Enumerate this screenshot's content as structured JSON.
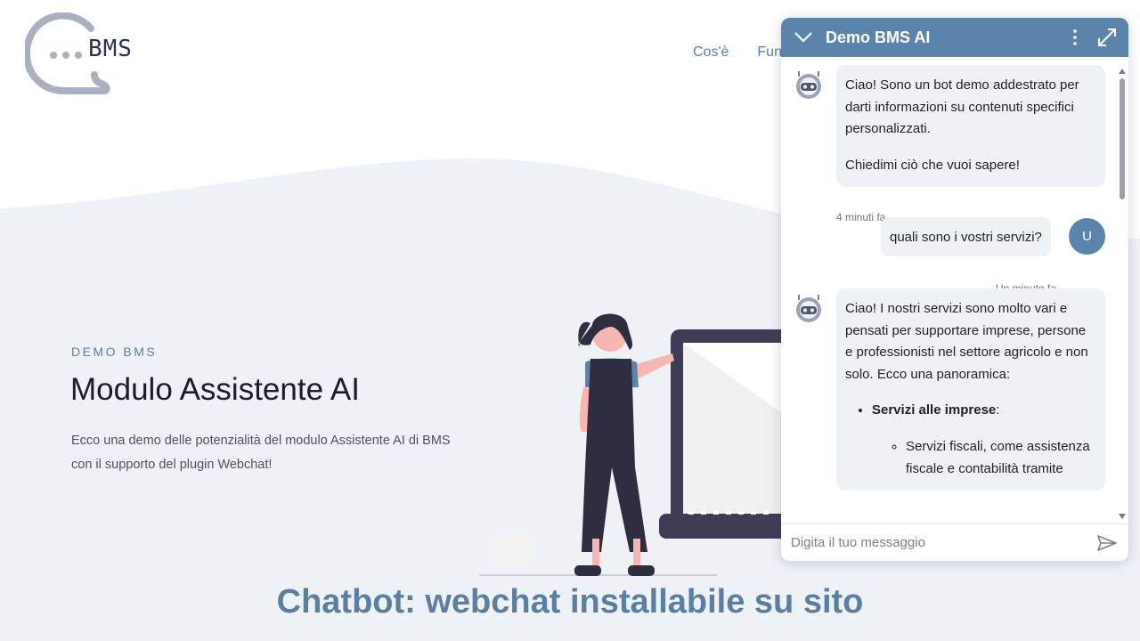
{
  "site": {
    "logo_text": "BMS",
    "nav": [
      "Cos'è",
      "Funz"
    ]
  },
  "hero": {
    "eyebrow": "DEMO BMS",
    "title": "Modulo Assistente AI",
    "description": "Ecco una demo delle potenzialità del modulo Assistente AI di BMS con il supporto del plugin Webchat!"
  },
  "bottom_heading": "Chatbot: webchat installabile su sito",
  "chat": {
    "title": "Demo BMS AI",
    "icons": {
      "collapse": "chevron-down-icon",
      "menu": "more-vertical-icon",
      "expand": "expand-icon",
      "send": "send-icon"
    },
    "messages": [
      {
        "sender": "bot",
        "paragraphs": [
          "Ciao! Sono un bot demo addestrato per darti informazioni su contenuti specifici personalizzati.",
          "Chiedimi ciò che vuoi sapere!"
        ],
        "time": "4 minuti fa"
      },
      {
        "sender": "user",
        "avatar": "U",
        "text": "quali sono i vostri servizi?",
        "time": "Un minuto fa"
      },
      {
        "sender": "bot",
        "intro": "Ciao! I nostri servizi sono molto vari e pensati per supportare imprese, persone e professionisti nel settore agricolo e non solo. Ecco una panoramica:",
        "list_item_bold": "Servizi alle imprese",
        "list_item_suffix": ":",
        "sub_item": "Servizi fiscali, come assistenza fiscale e contabilità tramite"
      }
    ],
    "input_placeholder": "Digita il tuo messaggio"
  },
  "colors": {
    "accent": "#5b84ab",
    "background_band": "#eef2f6",
    "bubble": "#eff2f5"
  }
}
